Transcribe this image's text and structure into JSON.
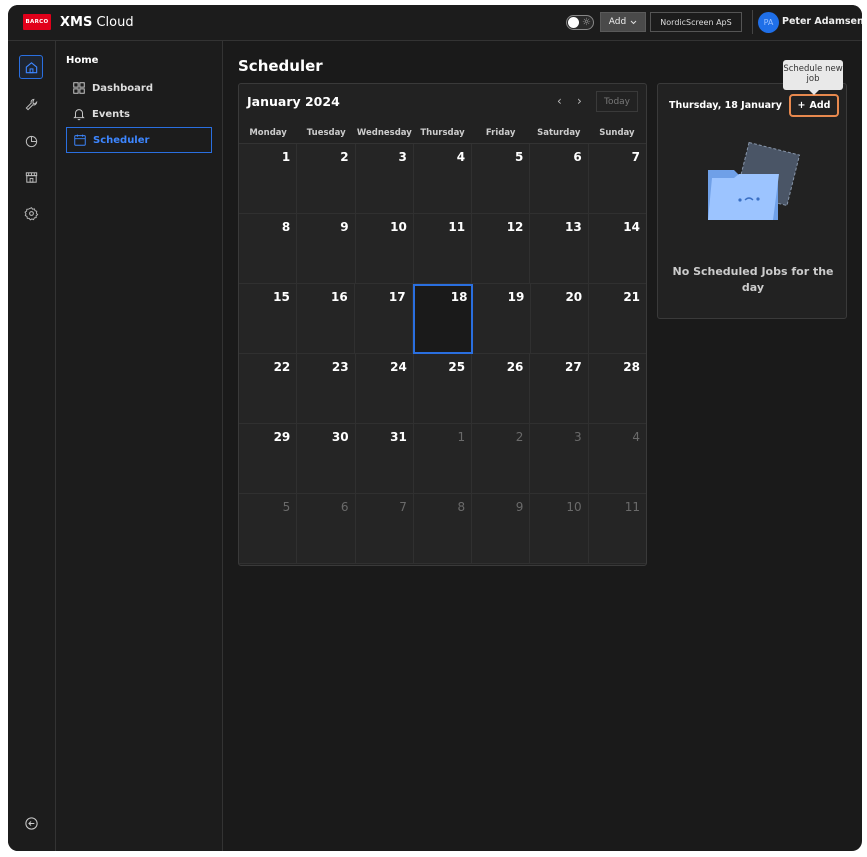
{
  "brand": {
    "logo_text": "BARCO",
    "name_bold": "XMS",
    "name_rest": " Cloud",
    "logo_color": "#e1001a"
  },
  "header": {
    "add_label": "Add",
    "org_label": "NordicScreen ApS",
    "avatar_initials": "PA",
    "user_name": "Peter Adamsen"
  },
  "rail": {
    "icons": [
      "home-icon",
      "wrench-icon",
      "pie-chart-icon",
      "store-icon",
      "settings-icon"
    ],
    "collapse_icon": "collapse-left-icon"
  },
  "nav": {
    "section": "Home",
    "items": [
      {
        "label": "Dashboard",
        "icon": "grid-icon"
      },
      {
        "label": "Events",
        "icon": "bell-icon"
      },
      {
        "label": "Scheduler",
        "icon": "calendar-icon",
        "active": true
      }
    ]
  },
  "page": {
    "title": "Scheduler"
  },
  "calendar": {
    "month_label": "January 2024",
    "today_label": "Today",
    "weekdays": [
      "Monday",
      "Tuesday",
      "Wednesday",
      "Thursday",
      "Friday",
      "Saturday",
      "Sunday"
    ],
    "weeks": [
      [
        "1",
        "2",
        "3",
        "4",
        "5",
        "6",
        "7"
      ],
      [
        "8",
        "9",
        "10",
        "11",
        "12",
        "13",
        "14"
      ],
      [
        "15",
        "16",
        "17",
        "18",
        "19",
        "20",
        "21"
      ],
      [
        "22",
        "23",
        "24",
        "25",
        "26",
        "27",
        "28"
      ],
      [
        "29",
        "30",
        "31",
        "1",
        "2",
        "3",
        "4"
      ],
      [
        "5",
        "6",
        "7",
        "8",
        "9",
        "10",
        "11"
      ]
    ],
    "muted": [
      [
        4,
        3
      ],
      [
        4,
        4
      ],
      [
        4,
        5
      ],
      [
        4,
        6
      ],
      [
        5,
        0
      ],
      [
        5,
        1
      ],
      [
        5,
        2
      ],
      [
        5,
        3
      ],
      [
        5,
        4
      ],
      [
        5,
        5
      ],
      [
        5,
        6
      ]
    ],
    "selected": [
      2,
      3
    ]
  },
  "day_panel": {
    "date": "Thursday, 18 January",
    "add_label": "Add",
    "empty_text": "No Scheduled Jobs for the day",
    "tooltip": "Schedule new job"
  },
  "colors": {
    "accent": "#2a6fe0",
    "focus": "#e8894e",
    "background": "#1a1a1a"
  }
}
